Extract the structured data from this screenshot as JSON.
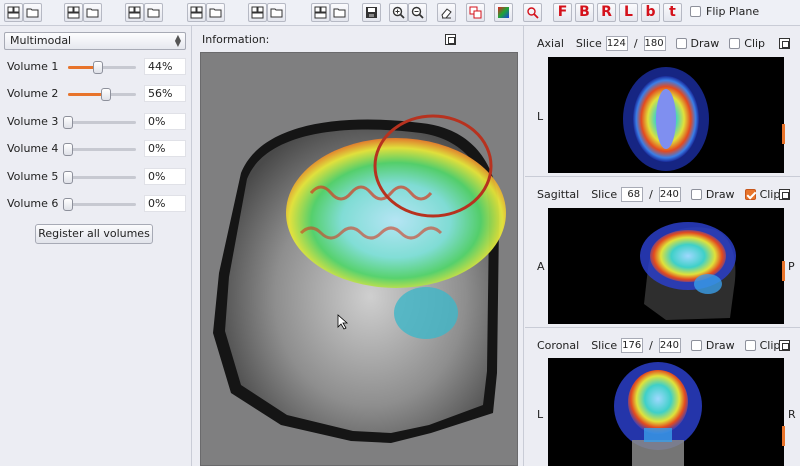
{
  "toolbar": {
    "flip_label": "Flip Plane",
    "flip_checked": false,
    "color_letters": [
      "F",
      "B",
      "R",
      "L",
      "b",
      "t"
    ]
  },
  "left": {
    "mode_select": "Multimodal",
    "volumes": [
      {
        "label": "Volume 1",
        "value": "44%",
        "fraction": 0.44
      },
      {
        "label": "Volume 2",
        "value": "56%",
        "fraction": 0.56
      },
      {
        "label": "Volume 3",
        "value": "0%",
        "fraction": 0
      },
      {
        "label": "Volume 4",
        "value": "0%",
        "fraction": 0
      },
      {
        "label": "Volume 5",
        "value": "0%",
        "fraction": 0
      },
      {
        "label": "Volume 6",
        "value": "0%",
        "fraction": 0
      }
    ],
    "register_label": "Register all volumes"
  },
  "center": {
    "info_label": "Information:"
  },
  "panels": [
    {
      "name": "Axial",
      "slice_label": "Slice",
      "slice": "124",
      "sep": "/",
      "total": "180",
      "draw_label": "Draw",
      "draw": false,
      "clip_label": "Clip",
      "clip": false,
      "left_side": "L",
      "right_side": ""
    },
    {
      "name": "Sagittal",
      "slice_label": "Slice",
      "slice": "68",
      "sep": "/",
      "total": "240",
      "draw_label": "Draw",
      "draw": false,
      "clip_label": "Clip",
      "clip": true,
      "left_side": "A",
      "right_side": "P"
    },
    {
      "name": "Coronal",
      "slice_label": "Slice",
      "slice": "176",
      "sep": "/",
      "total": "240",
      "draw_label": "Draw",
      "draw": false,
      "clip_label": "Clip",
      "clip": false,
      "left_side": "L",
      "right_side": "R"
    }
  ],
  "colors": {
    "accent": "#e8742b",
    "letter_red": "#d4111b",
    "panel_bg": "#ecedf3",
    "viewer_bg": "#7f7f80"
  },
  "icons": [
    "layout-icon",
    "open-folder-icon",
    "save-disk-icon",
    "zoom-in-icon",
    "zoom-out-icon",
    "eraser-icon",
    "color-copy-icon",
    "color-gradient-icon",
    "magnifier-icon",
    "pan-icon"
  ]
}
